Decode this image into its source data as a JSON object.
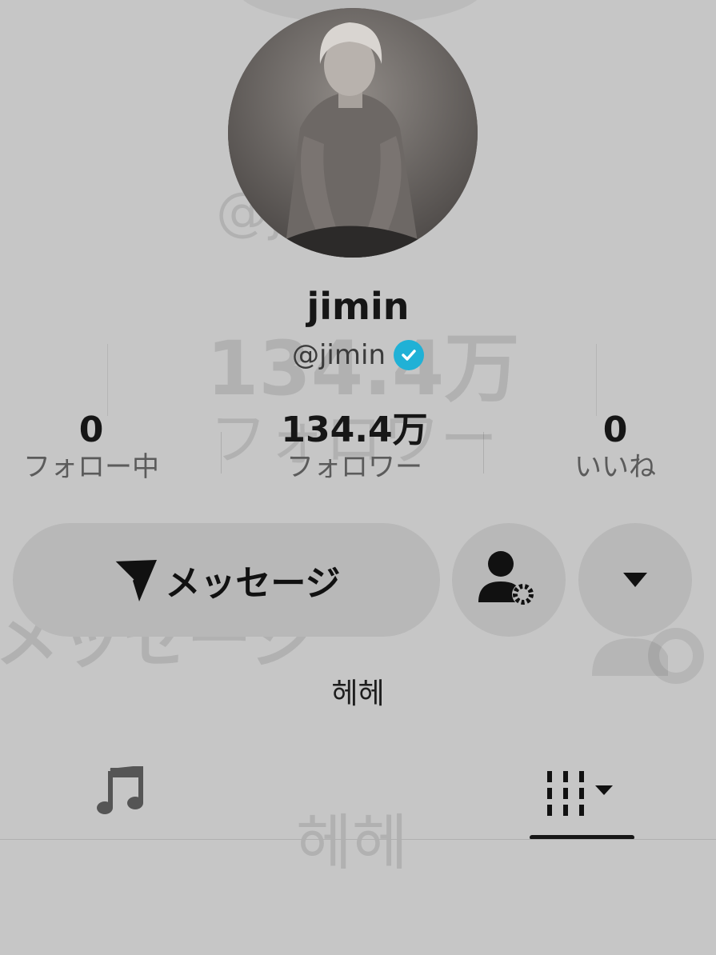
{
  "profile": {
    "display_name": "jimin",
    "handle": "@jimin",
    "verified": true,
    "bio": "헤헤"
  },
  "stats": [
    {
      "value": "0",
      "label": "フォロー中"
    },
    {
      "value": "134.4万",
      "label": "フォロワー"
    },
    {
      "value": "0",
      "label": "いいね"
    }
  ],
  "actions": {
    "message_label": "メッセージ"
  },
  "tabs": [
    {
      "icon": "music-note-icon"
    },
    {
      "icon": "grid-sort-icon",
      "selected": true
    }
  ],
  "colors": {
    "background": "#c6c6c6",
    "button": "#b8b8b8",
    "verified": "#20b1d6",
    "text": "#161616"
  }
}
